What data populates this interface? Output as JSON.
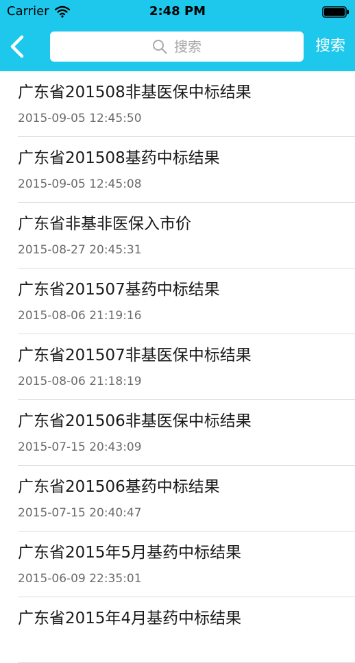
{
  "status_bar": {
    "carrier": "Carrier",
    "time": "2:48 PM"
  },
  "nav": {
    "back_icon": "chevron-left-icon",
    "search_icon": "search-icon",
    "search_placeholder": "搜索",
    "search_button": "搜索",
    "accent_color": "#1ec8ec"
  },
  "list": {
    "items": [
      {
        "title": "广东省201508非基医保中标结果",
        "date": "2015-09-05 12:45:50"
      },
      {
        "title": "广东省201508基药中标结果",
        "date": "2015-09-05 12:45:08"
      },
      {
        "title": "广东省非基非医保入市价",
        "date": "2015-08-27 20:45:31"
      },
      {
        "title": "广东省201507基药中标结果",
        "date": "2015-08-06 21:19:16"
      },
      {
        "title": "广东省201507非基医保中标结果",
        "date": "2015-08-06 21:18:19"
      },
      {
        "title": "广东省201506非基医保中标结果",
        "date": "2015-07-15 20:43:09"
      },
      {
        "title": "广东省201506基药中标结果",
        "date": "2015-07-15 20:40:47"
      },
      {
        "title": "广东省2015年5月基药中标结果",
        "date": "2015-06-09 22:35:01"
      },
      {
        "title": "广东省2015年4月基药中标结果",
        "date": ""
      }
    ]
  }
}
